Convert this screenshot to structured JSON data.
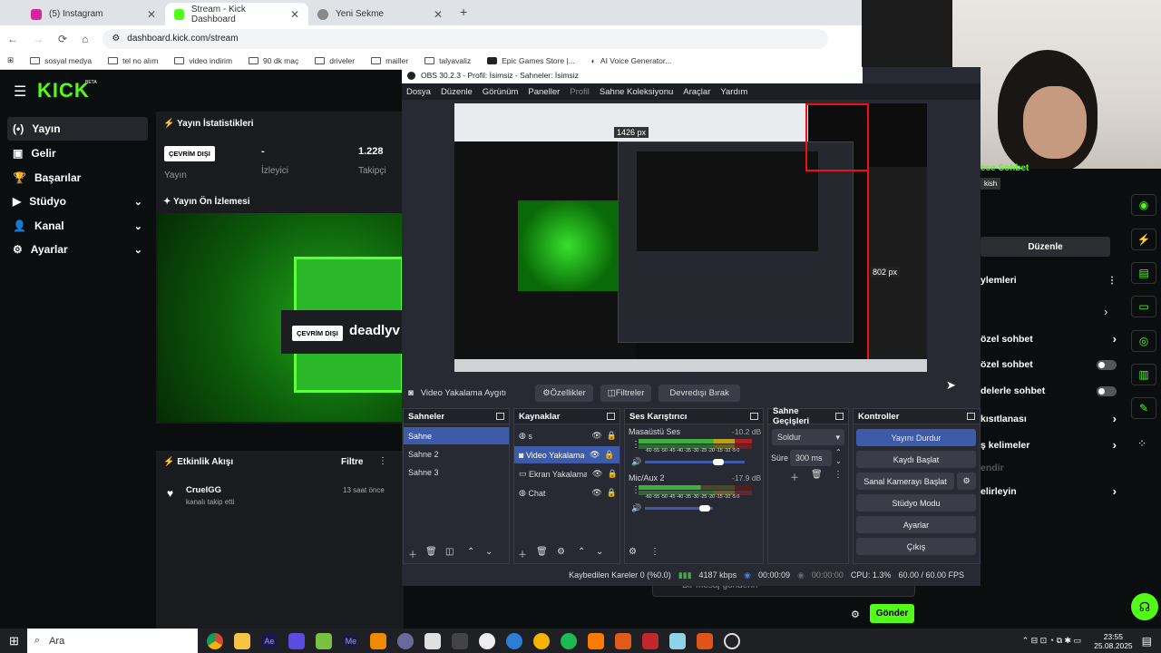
{
  "browser": {
    "tabs": [
      {
        "label": "(5) Instagram",
        "color": "#d6249f"
      },
      {
        "label": "Stream - Kick Dashboard",
        "color": "#53fc18"
      },
      {
        "label": "Yeni Sekme",
        "color": "#666"
      }
    ],
    "url": "dashboard.kick.com/stream",
    "bookmarks": [
      "sosyal medya",
      "tel no alım",
      "video indirim",
      "90 dk maç",
      "driveler",
      "mailler",
      "talyavaliz",
      "Epic Games Store |...",
      "AI Voice Generator..."
    ]
  },
  "kick": {
    "logo": "KICK",
    "beta": "BETA",
    "nav": [
      {
        "label": "Yayın",
        "icon": "(•)"
      },
      {
        "label": "Gelir",
        "icon": "▣"
      },
      {
        "label": "Başarılar",
        "icon": "🏆"
      },
      {
        "label": "Stüdyo",
        "icon": "▶"
      },
      {
        "label": "Kanal",
        "icon": "👤"
      },
      {
        "label": "Ayarlar",
        "icon": "⚙"
      }
    ],
    "stats_title": "Yayın İstatistikleri",
    "status_badge": "ÇEVRİM DIŞI",
    "status_label": "Yayın",
    "viewers_value": "-",
    "viewers_label": "İzleyici",
    "followers_value": "1.228",
    "followers_label": "Takipçi",
    "preview_title": "Yayın Ön İzlemesi",
    "preview_badge": "ÇEVRİM DIŞI",
    "preview_channel": "deadlyv",
    "activity_title": "Etkinlik Akışı",
    "activity_filter": "Filtre",
    "activity": {
      "user": "CruelGG",
      "text": "kanalı takip etti",
      "time": "13 saat önce"
    },
    "chat_placeholder": "Bir mesaj gönderin",
    "send": "Gönder"
  },
  "rightpanel": {
    "top": "ece Sohbet",
    "tag": "kish",
    "edit": "Düzenle",
    "section": "ylemleri",
    "items": [
      "özel sohbet",
      "özel sohbet",
      "delerle sohbet",
      "kısıtlanası",
      "ş kelimeler",
      "endir",
      "elirleyin"
    ]
  },
  "obs": {
    "title": "OBS 30.2.3 - Profil: İsimsiz - Sahneler: İsimsiz",
    "menu": [
      "Dosya",
      "Düzenle",
      "Görünüm",
      "Paneller",
      "Profil",
      "Sahne Koleksiyonu",
      "Araçlar",
      "Yardım"
    ],
    "source_name": "Video Yakalama Aygıtı",
    "props": "Özellikler",
    "filters": "Filtreler",
    "deactivate": "Devredışı Bırak",
    "scenes_title": "Sahneler",
    "scenes": [
      "Sahne",
      "Sahne 2",
      "Sahne 3"
    ],
    "sources_title": "Kaynaklar",
    "sources": [
      "s",
      "Video Yakalama",
      "Ekran Yakalama",
      "Chat"
    ],
    "mixer_title": "Ses Karıştırıcı",
    "tracks": [
      {
        "name": "Masaüstü Ses",
        "db": "-10.2 dB",
        "level": 0.8
      },
      {
        "name": "Mic/Aux 2",
        "db": "-17.9 dB",
        "level": 0.58
      }
    ],
    "ticks": "-60 -55 -50 -45 -40 -35 -30 -25 -20 -15 -10 -5 0",
    "transitions_title": "Sahne Geçişleri",
    "transition": "Soldur",
    "duration_label": "Süre",
    "duration": "300 ms",
    "controls_title": "Kontroller",
    "controls": [
      "Yayını Durdur",
      "Kaydı Başlat",
      "Sanal Kamerayı Başlat",
      "Stüdyo Modu",
      "Ayarlar",
      "Çıkış"
    ],
    "status": {
      "dropped": "Kaybedilen Kareler 0 (%0.0)",
      "bitrate": "4187 kbps",
      "stream_time": "00:00:09",
      "rec_time": "00:00:00",
      "cpu": "CPU: 1.3%",
      "fps": "60.00 / 60.00 FPS"
    },
    "preview_px1": "1426 px",
    "preview_px2": "802 px"
  },
  "taskbar": {
    "search": "Ara",
    "time": "23:55",
    "date": "25.08.2025"
  }
}
